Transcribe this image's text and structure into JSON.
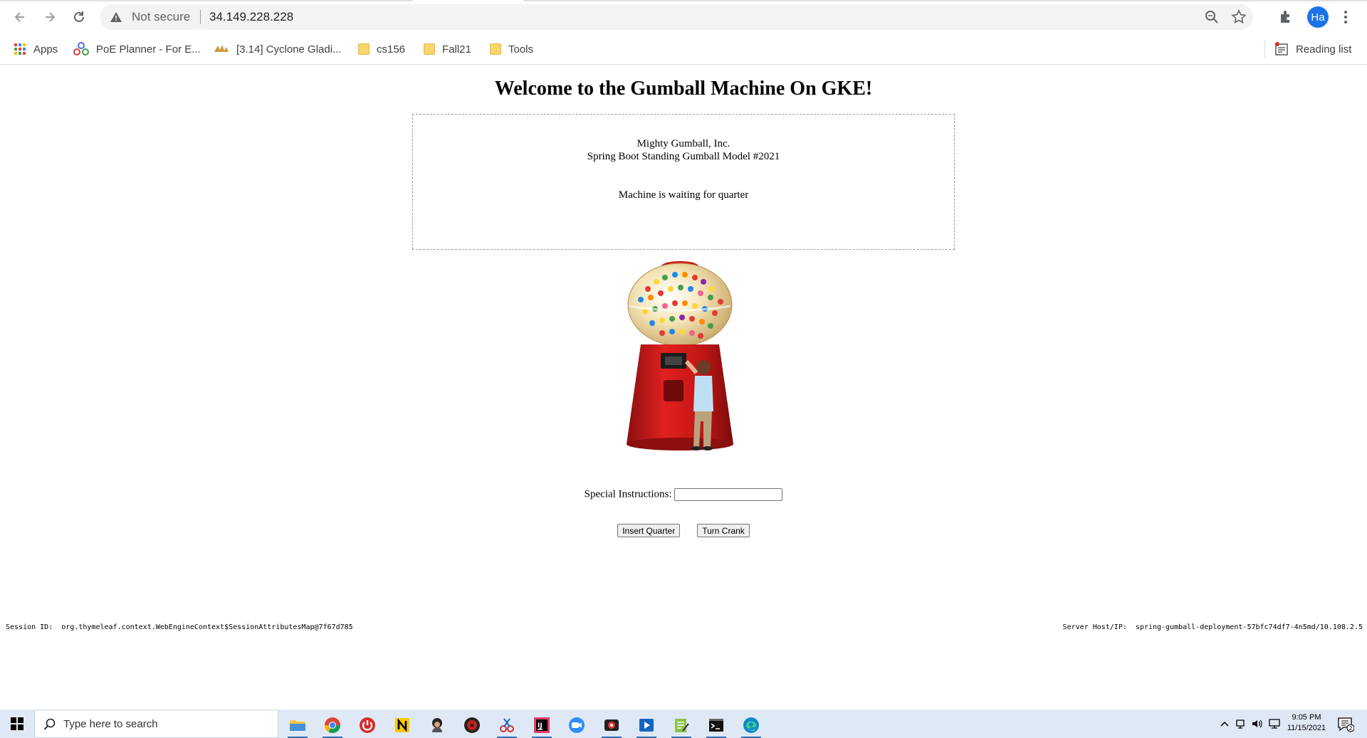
{
  "browser": {
    "security_label": "Not secure",
    "url": "34.149.228.228",
    "profile_initials": "Ha",
    "bookmarks": [
      {
        "label": "Apps",
        "icon": "apps-grid-icon"
      },
      {
        "label": "PoE Planner - For E...",
        "icon": "poe-planner-icon"
      },
      {
        "label": "[3.14] Cyclone Gladi...",
        "icon": "forum-site-icon"
      },
      {
        "label": "cs156",
        "icon": "folder-icon"
      },
      {
        "label": "Fall21",
        "icon": "folder-icon"
      },
      {
        "label": "Tools",
        "icon": "folder-icon"
      }
    ],
    "reading_list_label": "Reading list"
  },
  "page": {
    "heading": "Welcome to the Gumball Machine On GKE!",
    "company": "Mighty Gumball, Inc.",
    "model": "Spring Boot Standing Gumball Model #2021",
    "status_message": "Machine is waiting for quarter",
    "instructions_label": "Special Instructions:",
    "instructions_value": "",
    "insert_quarter_label": "Insert Quarter",
    "turn_crank_label": "Turn Crank",
    "session_label": "Session ID:",
    "session_value": "org.thymeleaf.context.WebEngineContext$SessionAttributesMap@7f67d785",
    "server_label": "Server Host/IP:",
    "server_value": "spring-gumball-deployment-57bfc74df7-4n5md/10.108.2.5"
  },
  "taskbar": {
    "search_placeholder": "Type here to search",
    "time": "9:05 PM",
    "date": "11/15/2021",
    "notification_count": "2",
    "apps": [
      "file-explorer-icon",
      "chrome-icon",
      "power-app-icon",
      "notion-icon",
      "avatar-app-icon",
      "red-app-icon",
      "snip-tool-icon",
      "intellij-icon",
      "zoom-icon",
      "recorder-icon",
      "media-player-icon",
      "notepad-icon",
      "terminal-icon",
      "edge-icon"
    ]
  }
}
